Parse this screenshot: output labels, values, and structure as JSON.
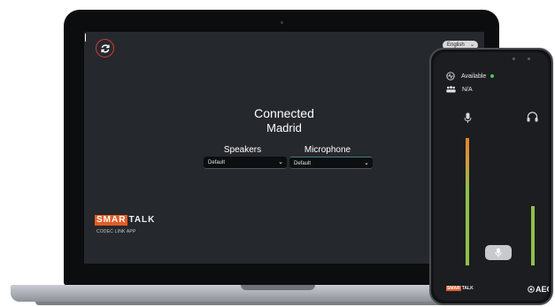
{
  "desktop": {
    "language": "English",
    "status_title": "Connected",
    "status_location": "Madrid",
    "speakers_label": "Speakers",
    "microphone_label": "Microphone",
    "speakers_value": "Default",
    "microphone_value": "Default",
    "brand_smar": "SMAR",
    "brand_talk": "TALK",
    "brand_tagline": "CODEC LINK APP",
    "icons": {
      "refresh": "refresh-icon",
      "chevron": "chevron-down-icon"
    }
  },
  "mobile": {
    "availability": "Available",
    "participants": "N/A",
    "brand_smar": "SMAR",
    "brand_talk": "TALK",
    "partner_logo": "AEO",
    "icons": {
      "activity": "activity-icon",
      "users": "users-icon",
      "microphone": "microphone-icon",
      "headphones": "headphones-icon"
    },
    "levels": {
      "input_meter": 1.0,
      "output_meter": 0.47
    }
  },
  "colors": {
    "accent": "#e35c26",
    "refresh_ring": "#d23c3c",
    "available": "#49c74a",
    "meter": "#8fc04a"
  }
}
